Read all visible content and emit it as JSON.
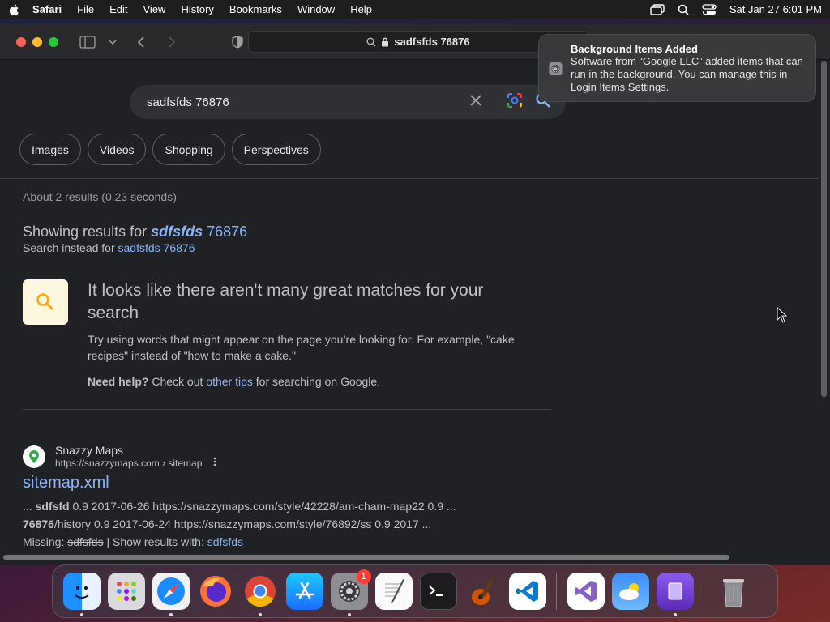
{
  "menubar": {
    "app_name": "Safari",
    "menus": [
      "File",
      "Edit",
      "View",
      "History",
      "Bookmarks",
      "Window",
      "Help"
    ],
    "datetime": "Sat Jan 27  6:01 PM"
  },
  "browser": {
    "url": "sadfsfds 76876"
  },
  "notification": {
    "title": "Background Items Added",
    "body": "Software from “Google LLC” added items that can run in the background. You can manage this in Login Items Settings."
  },
  "search": {
    "query": "sadfsfds 76876",
    "chips": [
      "Images",
      "Videos",
      "Shopping",
      "Perspectives"
    ],
    "stats": "About 2 results (0.23 seconds)",
    "showing_prefix": "Showing results for ",
    "showing_corrected_bold": "sdfsfds",
    "showing_corrected_rest": " 76876",
    "instead_prefix": "Search instead for ",
    "instead_link": "sadfsfds 76876"
  },
  "tip": {
    "title": "It looks like there aren't many great matches for your search",
    "body": "Try using words that might appear on the page you’re looking for. For example, \"cake recipes\" instead of \"how to make a cake.\"",
    "help_bold": "Need help?",
    "help_pre": " Check out ",
    "help_link": "other tips",
    "help_post": " for searching on Google."
  },
  "result": {
    "site_name": "Snazzy Maps",
    "site_url": "https://snazzymaps.com › sitemap",
    "title": "sitemap.xml",
    "snippet_l1_pre": "... ",
    "snippet_l1_bold": "sdfsfd",
    "snippet_l1_rest": " 0.9 2017-06-26 https://snazzymaps.com/style/42228/am-cham-map22 0.9 ...",
    "snippet_l2_bold": "76876",
    "snippet_l2_rest": "/history 0.9 2017-06-24 https://snazzymaps.com/style/76892/ss 0.9 2017 ...",
    "missing_label": "Missing: ",
    "missing_term": "sdfsfds",
    "show_with_label": " | Show results with: ",
    "show_with_link": "sdfsfds"
  },
  "dock": {
    "apps": [
      "finder-icon",
      "launchpad-icon",
      "safari-icon",
      "firefox-icon",
      "chrome-icon",
      "app-store-icon",
      "system-settings-icon",
      "textedit-icon",
      "terminal-icon",
      "garageband-icon",
      "vscode-icon",
      "visual-studio-icon",
      "weather-icon",
      "simulator-icon",
      "trash-icon"
    ],
    "system_settings_badge": "1"
  }
}
